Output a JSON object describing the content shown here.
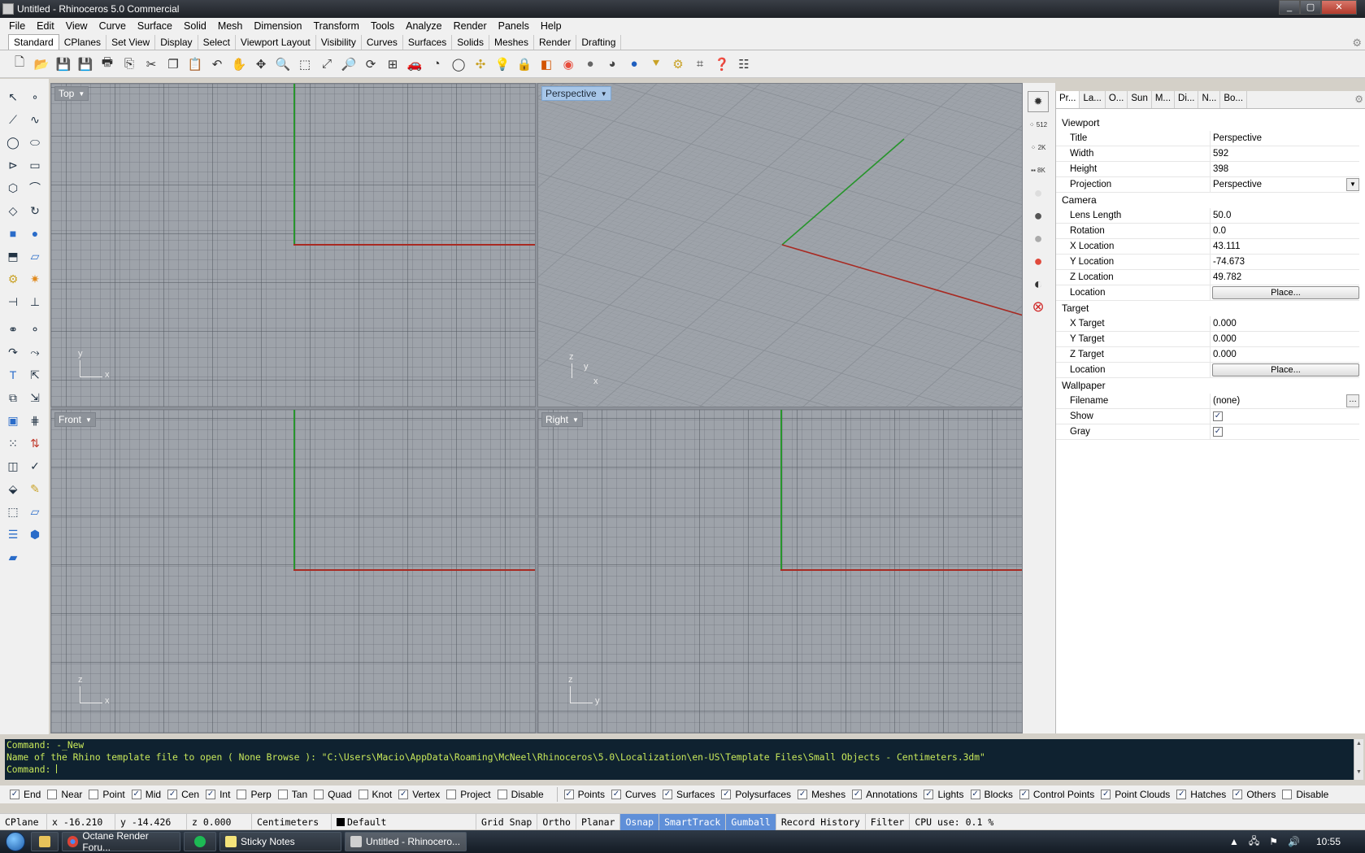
{
  "window": {
    "title": "Untitled - Rhinoceros 5.0 Commercial",
    "controls": [
      "_",
      "▢",
      "✕"
    ]
  },
  "menu": [
    "File",
    "Edit",
    "View",
    "Curve",
    "Surface",
    "Solid",
    "Mesh",
    "Dimension",
    "Transform",
    "Tools",
    "Analyze",
    "Render",
    "Panels",
    "Help"
  ],
  "toolbar_tabs": [
    "Standard",
    "CPlanes",
    "Set View",
    "Display",
    "Select",
    "Viewport Layout",
    "Visibility",
    "Curves",
    "Surfaces",
    "Solids",
    "Meshes",
    "Render",
    "Drafting"
  ],
  "toolbar_icons": [
    "new-icon",
    "open-icon",
    "save-icon",
    "save-as-icon",
    "print-icon",
    "import-icon",
    "cut-icon",
    "copy-icon",
    "paste-icon",
    "undo-icon",
    "pan-icon",
    "move-icon",
    "zoom-icon",
    "zoom-window-icon",
    "zoom-extents-icon",
    "zoom-selected-icon",
    "rotate-view-icon",
    "four-viewports-icon",
    "car-icon",
    "render-preview-icon",
    "circle-icon",
    "point-icon",
    "light-bulb-icon",
    "lock-icon",
    "layer-icon",
    "color-wheel-icon",
    "shaded-sphere-icon",
    "rendered-sphere-icon",
    "blue-sphere-icon",
    "select-icon",
    "gear-icon",
    "grid-icon",
    "help-icon",
    "options-icon"
  ],
  "viewports": {
    "top": {
      "label": "Top",
      "axes": [
        "y",
        "x"
      ]
    },
    "perspective": {
      "label": "Perspective",
      "axes": [
        "z",
        "y",
        "x"
      ]
    },
    "front": {
      "label": "Front",
      "axes": [
        "z",
        "x"
      ]
    },
    "right": {
      "label": "Right",
      "axes": [
        "z",
        "y"
      ]
    }
  },
  "props": {
    "tabs": [
      "Pr...",
      "La...",
      "O...",
      "Sun",
      "M...",
      "Di...",
      "N...",
      "Bo..."
    ],
    "viewport": {
      "section": "Viewport",
      "rows": [
        {
          "key": "Title",
          "value": "Perspective"
        },
        {
          "key": "Width",
          "value": "592"
        },
        {
          "key": "Height",
          "value": "398"
        },
        {
          "key": "Projection",
          "value": "Perspective"
        }
      ]
    },
    "camera": {
      "section": "Camera",
      "rows": [
        {
          "key": "Lens Length",
          "value": "50.0"
        },
        {
          "key": "Rotation",
          "value": "0.0"
        },
        {
          "key": "X Location",
          "value": "43.111"
        },
        {
          "key": "Y Location",
          "value": "-74.673"
        },
        {
          "key": "Z Location",
          "value": "49.782"
        },
        {
          "key": "Location",
          "value": "Place..."
        }
      ]
    },
    "target": {
      "section": "Target",
      "rows": [
        {
          "key": "X Target",
          "value": "0.000"
        },
        {
          "key": "Y Target",
          "value": "0.000"
        },
        {
          "key": "Z Target",
          "value": "0.000"
        },
        {
          "key": "Location",
          "value": "Place..."
        }
      ]
    },
    "wallpaper": {
      "section": "Wallpaper",
      "rows": [
        {
          "key": "Filename",
          "value": "(none)"
        },
        {
          "key": "Show",
          "value": "✓"
        },
        {
          "key": "Gray",
          "value": "✓"
        }
      ]
    }
  },
  "command": {
    "lines": [
      "Command: -_New",
      "Name of the Rhino template file to open ( None  Browse ): \"C:\\Users\\Macio\\AppData\\Roaming\\McNeel\\Rhinoceros\\5.0\\Localization\\en-US\\Template Files\\Small Objects - Centimeters.3dm\""
    ],
    "prompt": "Command:"
  },
  "osnaps": [
    {
      "label": "End",
      "checked": true
    },
    {
      "label": "Near",
      "checked": false
    },
    {
      "label": "Point",
      "checked": false
    },
    {
      "label": "Mid",
      "checked": true
    },
    {
      "label": "Cen",
      "checked": true
    },
    {
      "label": "Int",
      "checked": true
    },
    {
      "label": "Perp",
      "checked": false
    },
    {
      "label": "Tan",
      "checked": false
    },
    {
      "label": "Quad",
      "checked": false
    },
    {
      "label": "Knot",
      "checked": false
    },
    {
      "label": "Vertex",
      "checked": true
    },
    {
      "label": "Project",
      "checked": false
    },
    {
      "label": "Disable",
      "checked": false
    }
  ],
  "filters": [
    {
      "label": "Points",
      "checked": true
    },
    {
      "label": "Curves",
      "checked": true
    },
    {
      "label": "Surfaces",
      "checked": true
    },
    {
      "label": "Polysurfaces",
      "checked": true
    },
    {
      "label": "Meshes",
      "checked": true
    },
    {
      "label": "Annotations",
      "checked": true
    },
    {
      "label": "Lights",
      "checked": true
    },
    {
      "label": "Blocks",
      "checked": true
    },
    {
      "label": "Control Points",
      "checked": true
    },
    {
      "label": "Point Clouds",
      "checked": true
    },
    {
      "label": "Hatches",
      "checked": true
    },
    {
      "label": "Others",
      "checked": true
    },
    {
      "label": "Disable",
      "checked": false
    }
  ],
  "status": {
    "cplane": "CPlane",
    "x": "x -16.210",
    "y": "y -14.426",
    "z": "z 0.000",
    "units": "Centimeters",
    "layer": "Default",
    "grid_snap": "Grid Snap",
    "ortho": "Ortho",
    "planar": "Planar",
    "osnap": "Osnap",
    "smarttrack": "SmartTrack",
    "gumball": "Gumball",
    "record_history": "Record History",
    "filter": "Filter",
    "cpu": "CPU use: 0.1 %"
  },
  "taskbar": {
    "items": [
      {
        "label": "Octane Render Foru...",
        "icon": "chrome-icon"
      },
      {
        "label": "",
        "icon": "spotify-icon"
      },
      {
        "label": "Sticky Notes",
        "icon": "sticky-notes-icon"
      },
      {
        "label": "Untitled - Rhinocero...",
        "icon": "rhino-icon"
      }
    ],
    "clock": "10:55"
  },
  "colors": {
    "x_axis": "#a82a22",
    "y_axis": "#27952c",
    "viewport_bg": "#9ea3aa",
    "command_text": "#c8e85a",
    "active_status": "#5f8fd8"
  }
}
